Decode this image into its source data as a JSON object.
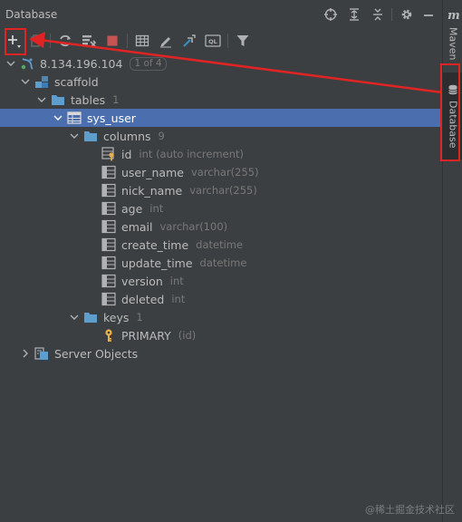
{
  "panel": {
    "title": "Database"
  },
  "side_tabs": {
    "maven": "Maven",
    "database": "Database"
  },
  "tree": {
    "connection": {
      "label": "8.134.196.104",
      "badge": "1 of 4"
    },
    "schema": {
      "label": "scaffold"
    },
    "tables_folder": {
      "label": "tables",
      "count": "1"
    },
    "table": {
      "label": "sys_user"
    },
    "columns_folder": {
      "label": "columns",
      "count": "9"
    },
    "columns": [
      {
        "name": "id",
        "type": "int (auto increment)"
      },
      {
        "name": "user_name",
        "type": "varchar(255)"
      },
      {
        "name": "nick_name",
        "type": "varchar(255)"
      },
      {
        "name": "age",
        "type": "int"
      },
      {
        "name": "email",
        "type": "varchar(100)"
      },
      {
        "name": "create_time",
        "type": "datetime"
      },
      {
        "name": "update_time",
        "type": "datetime"
      },
      {
        "name": "version",
        "type": "int"
      },
      {
        "name": "deleted",
        "type": "int"
      }
    ],
    "keys_folder": {
      "label": "keys",
      "count": "1"
    },
    "key": {
      "name": "PRIMARY",
      "type": "(id)"
    },
    "server_objects": {
      "label": "Server Objects"
    }
  },
  "watermark": "@稀土掘金技术社区",
  "colors": {
    "background": "#3c3f41",
    "selection": "#4b6eaf",
    "annotation": "#e02424",
    "folder": "#5d9ecf"
  },
  "icons": {
    "toolbar": [
      "add-icon",
      "duplicate-icon",
      "refresh-icon",
      "properties-icon",
      "stop-icon",
      "table-editor-icon",
      "edit-icon",
      "jump-icon",
      "query-console-icon",
      "filter-icon"
    ],
    "titlebar": [
      "crosshair-icon",
      "expand-all-icon",
      "collapse-all-icon",
      "gear-icon",
      "minimize-icon"
    ]
  }
}
